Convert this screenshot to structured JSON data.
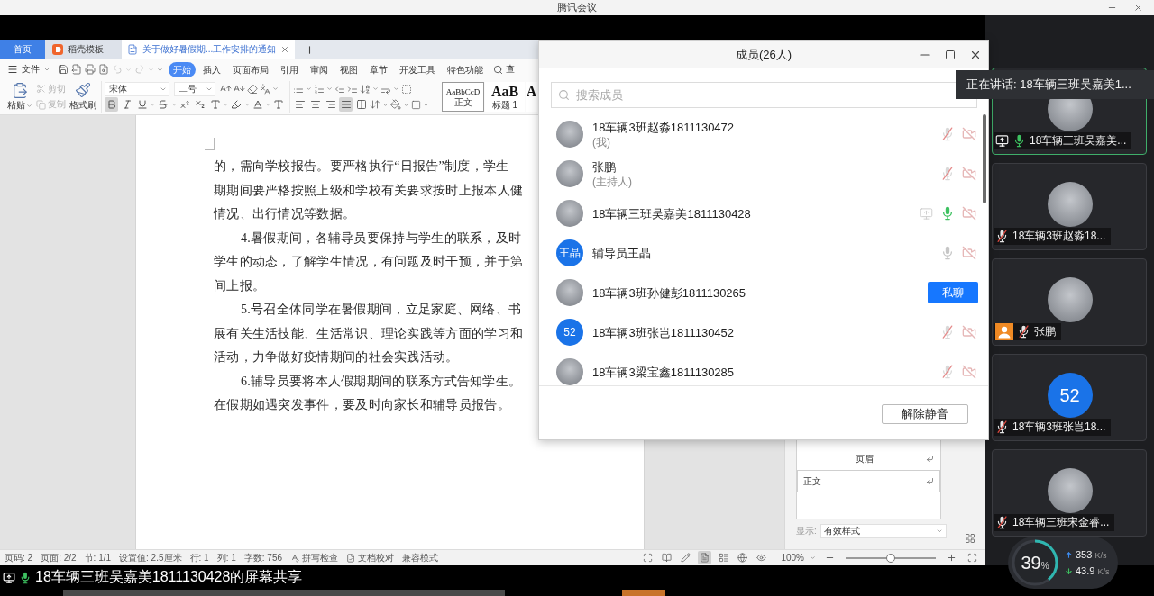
{
  "meeting_window": {
    "title": "腾讯会议"
  },
  "wps": {
    "tabs": [
      {
        "label": "首页",
        "kind": "home",
        "selected": false
      },
      {
        "label": "稻壳模板",
        "kind": "template",
        "selected": false
      },
      {
        "label": "关于做好暑假期...工作安排的通知",
        "kind": "document",
        "selected": true
      }
    ],
    "menu": {
      "file_label": "文件",
      "quick_access": [
        {
          "disabled": false
        },
        {
          "disabled": false
        },
        {
          "disabled": false
        },
        {
          "disabled": false
        },
        {
          "disabled": true
        },
        {
          "disabled": true
        }
      ],
      "tabs": [
        {
          "label": "开始",
          "selected": true
        },
        {
          "label": "插入",
          "selected": false
        },
        {
          "label": "页面布局",
          "selected": false
        },
        {
          "label": "引用",
          "selected": false
        },
        {
          "label": "审阅",
          "selected": false
        },
        {
          "label": "视图",
          "selected": false
        },
        {
          "label": "章节",
          "selected": false
        },
        {
          "label": "开发工具",
          "selected": false
        },
        {
          "label": "特色功能",
          "selected": false
        }
      ],
      "search_label": "查"
    },
    "ribbon": {
      "clipboard": [
        {
          "label": "粘贴",
          "disabled": false
        },
        {
          "label": "剪切",
          "disabled": true
        },
        {
          "label": "复制",
          "disabled": true
        },
        {
          "label": "格式刷",
          "disabled": false
        }
      ],
      "font_name": "宋体",
      "font_size": "二号",
      "format_buttons": [
        {
          "selected": true
        },
        {
          "selected": false
        },
        {
          "selected": false
        },
        {
          "selected": false
        },
        {
          "selected": false
        },
        {
          "selected": false
        },
        {
          "selected": false
        },
        {
          "selected": false
        },
        {
          "selected": false
        },
        {
          "selected": false
        }
      ],
      "align_buttons": [
        {
          "selected": false
        },
        {
          "selected": false
        },
        {
          "selected": false
        },
        {
          "selected": true
        },
        {
          "selected": false
        }
      ],
      "styles": [
        {
          "preview": "AaBbCcD",
          "label": "正文",
          "kind": "body",
          "selected": true
        },
        {
          "preview": "AaB",
          "label": "标题 1",
          "kind": "heading",
          "selected": false
        },
        {
          "preview": "A",
          "kind": "heading",
          "selected": false
        }
      ]
    },
    "document": {
      "paragraphs": [
        {
          "continued": true,
          "lines": [
            "的，需向学校报告。要严格执行“日报告”制度，学生",
            "期期间要严格按照上级和学校有关要求按时上报本人健",
            "情况、出行情况等数据。"
          ]
        },
        {
          "continued": false,
          "lines": [
            "4.暑假期间，各辅导员要保持与学生的联系，及时",
            "学生的动态，了解学生情况，有问题及时干预，并于第",
            "间上报。"
          ]
        },
        {
          "continued": false,
          "lines": [
            "5.号召全体同学在暑假期间，立足家庭、网络、书",
            "展有关生活技能、生活常识、理论实践等方面的学习和",
            "活动，力争做好疫情期间的社会实践活动。"
          ]
        },
        {
          "continued": false,
          "lines": [
            "6.辅导员要将本人假期期间的联系方式告知学生。",
            "在假期如遇突发事件，要及时向家长和辅导员报告。"
          ]
        }
      ]
    },
    "style_pane": {
      "styles": [
        {
          "label": "页眉",
          "kind": "header",
          "selected": false
        },
        {
          "label": "正文",
          "kind": "body",
          "selected": true
        }
      ],
      "show_label": "显示:",
      "show_value": "有效样式"
    },
    "status_bar": {
      "items": [
        "页码: 2",
        "页面: 2/2",
        "节: 1/1",
        "设置值: 2.5厘米",
        "行: 1",
        "列: 1",
        "字数: 756"
      ],
      "tools": [
        "拼写检查",
        "文档校对"
      ],
      "mode": "兼容模式",
      "views": [
        {
          "selected": false
        },
        {
          "selected": false
        },
        {
          "selected": false
        },
        {
          "selected": true
        },
        {
          "selected": false
        },
        {
          "selected": false
        },
        {
          "selected": false
        }
      ],
      "zoom": "100%",
      "zoom_slider": {
        "level": 0.5
      }
    }
  },
  "members_panel": {
    "title": "成员(26人)",
    "search_placeholder": "搜索成员",
    "members": [
      {
        "name": "18车辆3班赵淼1811130472",
        "role": "(我)",
        "avatar": {
          "kind": "photo"
        },
        "kind": "status",
        "sharing": false,
        "muted": true,
        "speaking": false,
        "camera_on": false
      },
      {
        "name": "张鹏",
        "role": "(主持人)",
        "avatar": {
          "kind": "photo"
        },
        "kind": "status",
        "sharing": false,
        "muted": true,
        "speaking": false,
        "camera_on": false
      },
      {
        "name": "18车辆三班吴嘉美1811130428",
        "avatar": {
          "kind": "photo"
        },
        "kind": "status",
        "sharing": true,
        "muted": false,
        "speaking": true,
        "camera_on": false
      },
      {
        "name": "辅导员王晶",
        "avatar": {
          "kind": "initials",
          "text": "王晶"
        },
        "kind": "status",
        "sharing": false,
        "muted": false,
        "speaking": false,
        "camera_on": false
      },
      {
        "name": "18车辆3班孙健彭1811130265",
        "avatar": {
          "kind": "photo"
        },
        "kind": "action",
        "action_label": "私聊"
      },
      {
        "name": "18车辆3班张岂1811130452",
        "avatar": {
          "kind": "initials",
          "text": "52"
        },
        "kind": "status",
        "sharing": false,
        "muted": true,
        "speaking": false,
        "camera_on": false
      },
      {
        "name": "18车辆3梁宝鑫1811130285",
        "avatar": {
          "kind": "photo"
        },
        "kind": "status",
        "sharing": false,
        "muted": true,
        "speaking": false,
        "camera_on": false
      }
    ],
    "footer_button": "解除静音"
  },
  "speaker_tooltip": {
    "text": "正在讲话: 18车辆三班吴嘉美1..."
  },
  "gallery": {
    "tiles": [
      {
        "name": "18车辆三班吴嘉美...",
        "avatar": {
          "kind": "photo"
        },
        "muted": false,
        "sharing": true,
        "host": false,
        "speaking": true
      },
      {
        "name": "18车辆3班赵淼18...",
        "avatar": {
          "kind": "photo"
        },
        "muted": true,
        "sharing": false,
        "host": false,
        "speaking": false
      },
      {
        "name": "张鹏",
        "avatar": {
          "kind": "photo"
        },
        "muted": true,
        "sharing": false,
        "host": true,
        "speaking": false
      },
      {
        "name": "18车辆3班张岂18...",
        "avatar": {
          "kind": "initials",
          "text": "52"
        },
        "muted": true,
        "sharing": false,
        "host": false,
        "speaking": false
      },
      {
        "name": "18车辆三班宋金睿...",
        "avatar": {
          "kind": "photo"
        },
        "muted": true,
        "sharing": false,
        "host": false,
        "speaking": false
      }
    ]
  },
  "network": {
    "usage_value": "39",
    "usage_unit": "%",
    "level": 0.39,
    "upload": {
      "value": "353",
      "unit": "K/s"
    },
    "download": {
      "value": "43.9",
      "unit": "K/s"
    }
  },
  "share_caption": {
    "text": "18车辆三班吴嘉美1811130428的屏幕共享",
    "sharing": true,
    "speaking": true
  }
}
